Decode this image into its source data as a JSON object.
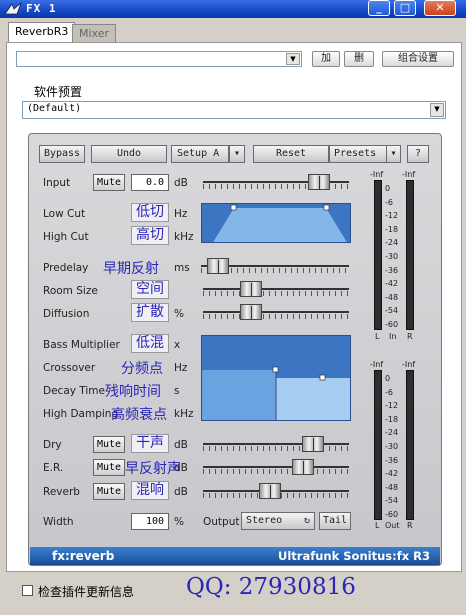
{
  "window": {
    "title": "FX 1",
    "min_label": "_",
    "max_label": "□",
    "close_label": "✕"
  },
  "tabs": [
    {
      "label": "ReverbR3"
    },
    {
      "label": "Mixer"
    }
  ],
  "toolbar": {
    "add_label": "加",
    "delete_label": "删",
    "combine_label": "组合设置"
  },
  "preset_section": {
    "label": "软件预置",
    "value": "(Default)"
  },
  "plugin": {
    "buttons": {
      "bypass": "Bypass",
      "undo": "Undo",
      "setup": "Setup A",
      "reset": "Reset",
      "presets": "Presets",
      "help": "?"
    },
    "params": {
      "input": {
        "label": "Input",
        "mute": "Mute",
        "value": "0.0",
        "unit": "dB",
        "level": 0.85
      },
      "low_cut": {
        "label": "Low Cut",
        "value": "低切",
        "unit": "Hz"
      },
      "high_cut": {
        "label": "High Cut",
        "value": "高切",
        "unit": "kHz"
      },
      "predelay": {
        "label": "Predelay",
        "value": "早期反射",
        "unit": "ms",
        "level": 0.05
      },
      "room_size": {
        "label": "Room Size",
        "value": "空间",
        "unit": "",
        "level": 0.3
      },
      "diffusion": {
        "label": "Diffusion",
        "value": "扩散",
        "unit": "%",
        "level": 0.3
      },
      "bass_multiplier": {
        "label": "Bass Multiplier",
        "value": "低混",
        "unit": "x"
      },
      "crossover": {
        "label": "Crossover",
        "value": "分频点",
        "unit": "Hz"
      },
      "decay_time": {
        "label": "Decay Time",
        "value": "残响时间",
        "unit": "s"
      },
      "high_damping": {
        "label": "High Damping",
        "value": "高频衰点",
        "unit": "kHz"
      },
      "dry": {
        "label": "Dry",
        "mute": "Mute",
        "value": "干声",
        "unit": "dB",
        "level": 0.8
      },
      "er": {
        "label": "E.R.",
        "mute": "Mute",
        "value": "早反射声",
        "unit": "dB",
        "level": 0.72
      },
      "reverb": {
        "label": "Reverb",
        "mute": "Mute",
        "value": "混响",
        "unit": "dB",
        "level": 0.45
      },
      "width": {
        "label": "Width",
        "value": "100",
        "unit": "%"
      },
      "output": {
        "label": "Output",
        "value": "Stereo",
        "tail": "Tail"
      }
    },
    "meters": {
      "scale": [
        "0",
        "-6",
        "-12",
        "-18",
        "-24",
        "-30",
        "-36",
        "-42",
        "-48",
        "-54",
        "-60"
      ],
      "inf_label": "-Inf",
      "in": {
        "left": "L",
        "mid": "In",
        "right": "R"
      },
      "out": {
        "left": "L",
        "mid": "Out",
        "right": "R"
      }
    },
    "brand_left": "fx:reverb",
    "brand_right": "Ultrafunk Sonitus:fx R3"
  },
  "footer": {
    "checkbox_label": "检查插件更新信息",
    "contact": "QQ: 27930816"
  }
}
